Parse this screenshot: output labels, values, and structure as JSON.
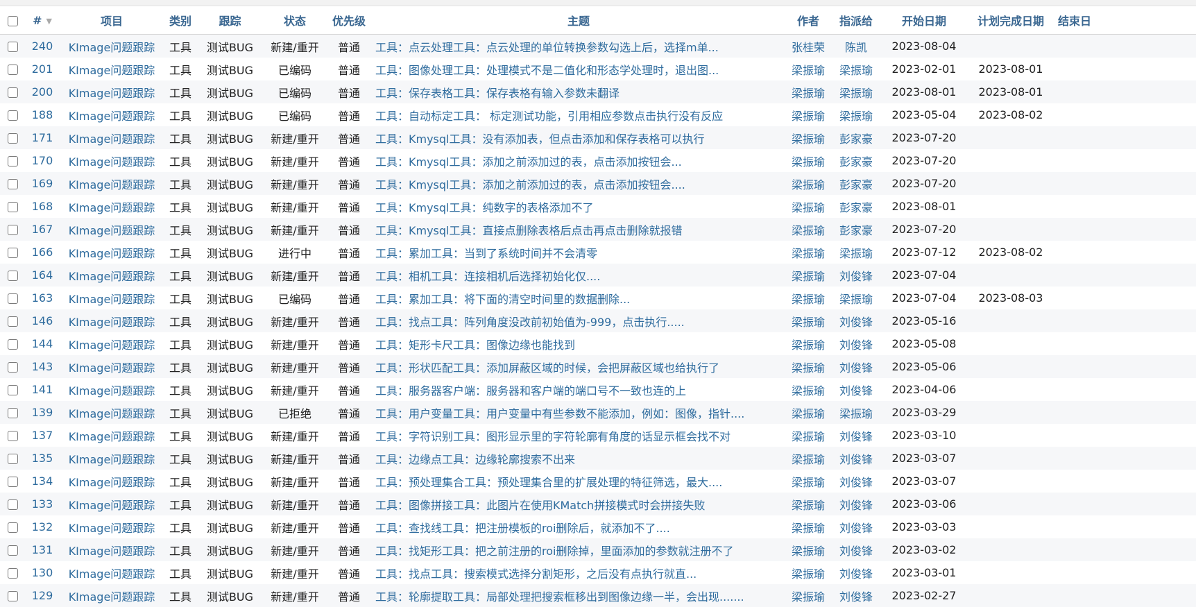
{
  "headers": {
    "id": "#",
    "project": "项目",
    "tracker": "类别",
    "tracking": "跟踪",
    "status": "状态",
    "priority": "优先级",
    "subject": "主题",
    "author": "作者",
    "assignee": "指派给",
    "start_date": "开始日期",
    "due_date": "计划完成日期",
    "end_date": "结束日"
  },
  "icons": {
    "sort": "sort-desc-icon",
    "checkbox": "checkbox-icon"
  },
  "colors": {
    "link": "#2f6c9e",
    "header": "#3a6791",
    "row_alt": "#f6f7f9"
  },
  "rows": [
    {
      "id": "240",
      "project": "KImage问题跟踪",
      "tracker": "工具",
      "tracking": "测试BUG",
      "status": "新建/重开",
      "priority": "普通",
      "subject": "工具：点云处理工具：点云处理的单位转换参数勾选上后，选择m单...",
      "author": "张桂荣",
      "assignee": "陈凯",
      "start": "2023-08-04",
      "due": "",
      "end": ""
    },
    {
      "id": "201",
      "project": "KImage问题跟踪",
      "tracker": "工具",
      "tracking": "测试BUG",
      "status": "已编码",
      "priority": "普通",
      "subject": "工具：图像处理工具：处理模式不是二值化和形态学处理时，退出图...",
      "author": "梁振瑜",
      "assignee": "梁振瑜",
      "start": "2023-02-01",
      "due": "2023-08-01",
      "end": ""
    },
    {
      "id": "200",
      "project": "KImage问题跟踪",
      "tracker": "工具",
      "tracking": "测试BUG",
      "status": "已编码",
      "priority": "普通",
      "subject": "工具：保存表格工具：保存表格有输入参数未翻译",
      "author": "梁振瑜",
      "assignee": "梁振瑜",
      "start": "2023-08-01",
      "due": "2023-08-01",
      "end": ""
    },
    {
      "id": "188",
      "project": "KImage问题跟踪",
      "tracker": "工具",
      "tracking": "测试BUG",
      "status": "已编码",
      "priority": "普通",
      "subject": "工具：自动标定工具： 标定测试功能，引用相应参数点击执行没有反应",
      "author": "梁振瑜",
      "assignee": "梁振瑜",
      "start": "2023-05-04",
      "due": "2023-08-02",
      "end": ""
    },
    {
      "id": "171",
      "project": "KImage问题跟踪",
      "tracker": "工具",
      "tracking": "测试BUG",
      "status": "新建/重开",
      "priority": "普通",
      "subject": "工具：Kmysql工具：没有添加表，但点击添加和保存表格可以执行",
      "author": "梁振瑜",
      "assignee": "彭家豪",
      "start": "2023-07-20",
      "due": "",
      "end": ""
    },
    {
      "id": "170",
      "project": "KImage问题跟踪",
      "tracker": "工具",
      "tracking": "测试BUG",
      "status": "新建/重开",
      "priority": "普通",
      "subject": "工具：Kmysql工具：添加之前添加过的表，点击添加按钮会...",
      "author": "梁振瑜",
      "assignee": "彭家豪",
      "start": "2023-07-20",
      "due": "",
      "end": ""
    },
    {
      "id": "169",
      "project": "KImage问题跟踪",
      "tracker": "工具",
      "tracking": "测试BUG",
      "status": "新建/重开",
      "priority": "普通",
      "subject": "工具：Kmysql工具：添加之前添加过的表，点击添加按钮会....",
      "author": "梁振瑜",
      "assignee": "彭家豪",
      "start": "2023-07-20",
      "due": "",
      "end": ""
    },
    {
      "id": "168",
      "project": "KImage问题跟踪",
      "tracker": "工具",
      "tracking": "测试BUG",
      "status": "新建/重开",
      "priority": "普通",
      "subject": "工具：Kmysql工具：纯数字的表格添加不了",
      "author": "梁振瑜",
      "assignee": "彭家豪",
      "start": "2023-08-01",
      "due": "",
      "end": ""
    },
    {
      "id": "167",
      "project": "KImage问题跟踪",
      "tracker": "工具",
      "tracking": "测试BUG",
      "status": "新建/重开",
      "priority": "普通",
      "subject": "工具：Kmysql工具：直接点删除表格后点击再点击删除就报错",
      "author": "梁振瑜",
      "assignee": "彭家豪",
      "start": "2023-07-20",
      "due": "",
      "end": ""
    },
    {
      "id": "166",
      "project": "KImage问题跟踪",
      "tracker": "工具",
      "tracking": "测试BUG",
      "status": "进行中",
      "priority": "普通",
      "subject": "工具：累加工具：当到了系统时间并不会清零",
      "author": "梁振瑜",
      "assignee": "梁振瑜",
      "start": "2023-07-12",
      "due": "2023-08-02",
      "end": ""
    },
    {
      "id": "164",
      "project": "KImage问题跟踪",
      "tracker": "工具",
      "tracking": "测试BUG",
      "status": "新建/重开",
      "priority": "普通",
      "subject": "工具：相机工具：连接相机后选择初始化仅....",
      "author": "梁振瑜",
      "assignee": "刘俊锋",
      "start": "2023-07-04",
      "due": "",
      "end": ""
    },
    {
      "id": "163",
      "project": "KImage问题跟踪",
      "tracker": "工具",
      "tracking": "测试BUG",
      "status": "已编码",
      "priority": "普通",
      "subject": "工具：累加工具：将下面的清空时间里的数据删除...",
      "author": "梁振瑜",
      "assignee": "梁振瑜",
      "start": "2023-07-04",
      "due": "2023-08-03",
      "end": ""
    },
    {
      "id": "146",
      "project": "KImage问题跟踪",
      "tracker": "工具",
      "tracking": "测试BUG",
      "status": "新建/重开",
      "priority": "普通",
      "subject": "工具：找点工具：阵列角度没改前初始值为-999，点击执行.....",
      "author": "梁振瑜",
      "assignee": "刘俊锋",
      "start": "2023-05-16",
      "due": "",
      "end": ""
    },
    {
      "id": "144",
      "project": "KImage问题跟踪",
      "tracker": "工具",
      "tracking": "测试BUG",
      "status": "新建/重开",
      "priority": "普通",
      "subject": "工具：矩形卡尺工具：图像边缘也能找到",
      "author": "梁振瑜",
      "assignee": "刘俊锋",
      "start": "2023-05-08",
      "due": "",
      "end": ""
    },
    {
      "id": "143",
      "project": "KImage问题跟踪",
      "tracker": "工具",
      "tracking": "测试BUG",
      "status": "新建/重开",
      "priority": "普通",
      "subject": "工具：形状匹配工具：添加屏蔽区域的时候，会把屏蔽区域也给执行了",
      "author": "梁振瑜",
      "assignee": "刘俊锋",
      "start": "2023-05-06",
      "due": "",
      "end": ""
    },
    {
      "id": "141",
      "project": "KImage问题跟踪",
      "tracker": "工具",
      "tracking": "测试BUG",
      "status": "新建/重开",
      "priority": "普通",
      "subject": "工具：服务器客户端：服务器和客户端的端口号不一致也连的上",
      "author": "梁振瑜",
      "assignee": "刘俊锋",
      "start": "2023-04-06",
      "due": "",
      "end": ""
    },
    {
      "id": "139",
      "project": "KImage问题跟踪",
      "tracker": "工具",
      "tracking": "测试BUG",
      "status": "已拒绝",
      "priority": "普通",
      "subject": "工具：用户变量工具：用户变量中有些参数不能添加，例如：图像，指针....",
      "author": "梁振瑜",
      "assignee": "梁振瑜",
      "start": "2023-03-29",
      "due": "",
      "end": ""
    },
    {
      "id": "137",
      "project": "KImage问题跟踪",
      "tracker": "工具",
      "tracking": "测试BUG",
      "status": "新建/重开",
      "priority": "普通",
      "subject": "工具：字符识别工具：图形显示里的字符轮廓有角度的话显示框会找不对",
      "author": "梁振瑜",
      "assignee": "刘俊锋",
      "start": "2023-03-10",
      "due": "",
      "end": ""
    },
    {
      "id": "135",
      "project": "KImage问题跟踪",
      "tracker": "工具",
      "tracking": "测试BUG",
      "status": "新建/重开",
      "priority": "普通",
      "subject": "工具：边缘点工具：边缘轮廓搜索不出来",
      "author": "梁振瑜",
      "assignee": "刘俊锋",
      "start": "2023-03-07",
      "due": "",
      "end": ""
    },
    {
      "id": "134",
      "project": "KImage问题跟踪",
      "tracker": "工具",
      "tracking": "测试BUG",
      "status": "新建/重开",
      "priority": "普通",
      "subject": "工具：预处理集合工具：预处理集合里的扩展处理的特征筛选，最大....",
      "author": "梁振瑜",
      "assignee": "刘俊锋",
      "start": "2023-03-07",
      "due": "",
      "end": ""
    },
    {
      "id": "133",
      "project": "KImage问题跟踪",
      "tracker": "工具",
      "tracking": "测试BUG",
      "status": "新建/重开",
      "priority": "普通",
      "subject": "工具：图像拼接工具：此图片在使用KMatch拼接模式时会拼接失败",
      "author": "梁振瑜",
      "assignee": "刘俊锋",
      "start": "2023-03-06",
      "due": "",
      "end": ""
    },
    {
      "id": "132",
      "project": "KImage问题跟踪",
      "tracker": "工具",
      "tracking": "测试BUG",
      "status": "新建/重开",
      "priority": "普通",
      "subject": "工具：查找线工具：把注册模板的roi删除后，就添加不了....",
      "author": "梁振瑜",
      "assignee": "刘俊锋",
      "start": "2023-03-03",
      "due": "",
      "end": ""
    },
    {
      "id": "131",
      "project": "KImage问题跟踪",
      "tracker": "工具",
      "tracking": "测试BUG",
      "status": "新建/重开",
      "priority": "普通",
      "subject": "工具：找矩形工具：把之前注册的roi删除掉，里面添加的参数就注册不了",
      "author": "梁振瑜",
      "assignee": "刘俊锋",
      "start": "2023-03-02",
      "due": "",
      "end": ""
    },
    {
      "id": "130",
      "project": "KImage问题跟踪",
      "tracker": "工具",
      "tracking": "测试BUG",
      "status": "新建/重开",
      "priority": "普通",
      "subject": "工具：找点工具：搜索模式选择分割矩形，之后没有点执行就直...",
      "author": "梁振瑜",
      "assignee": "刘俊锋",
      "start": "2023-03-01",
      "due": "",
      "end": ""
    },
    {
      "id": "129",
      "project": "KImage问题跟踪",
      "tracker": "工具",
      "tracking": "测试BUG",
      "status": "新建/重开",
      "priority": "普通",
      "subject": "工具：轮廓提取工具：局部处理把搜索框移出到图像边缘一半，会出现.......",
      "author": "梁振瑜",
      "assignee": "刘俊锋",
      "start": "2023-02-27",
      "due": "",
      "end": ""
    }
  ]
}
